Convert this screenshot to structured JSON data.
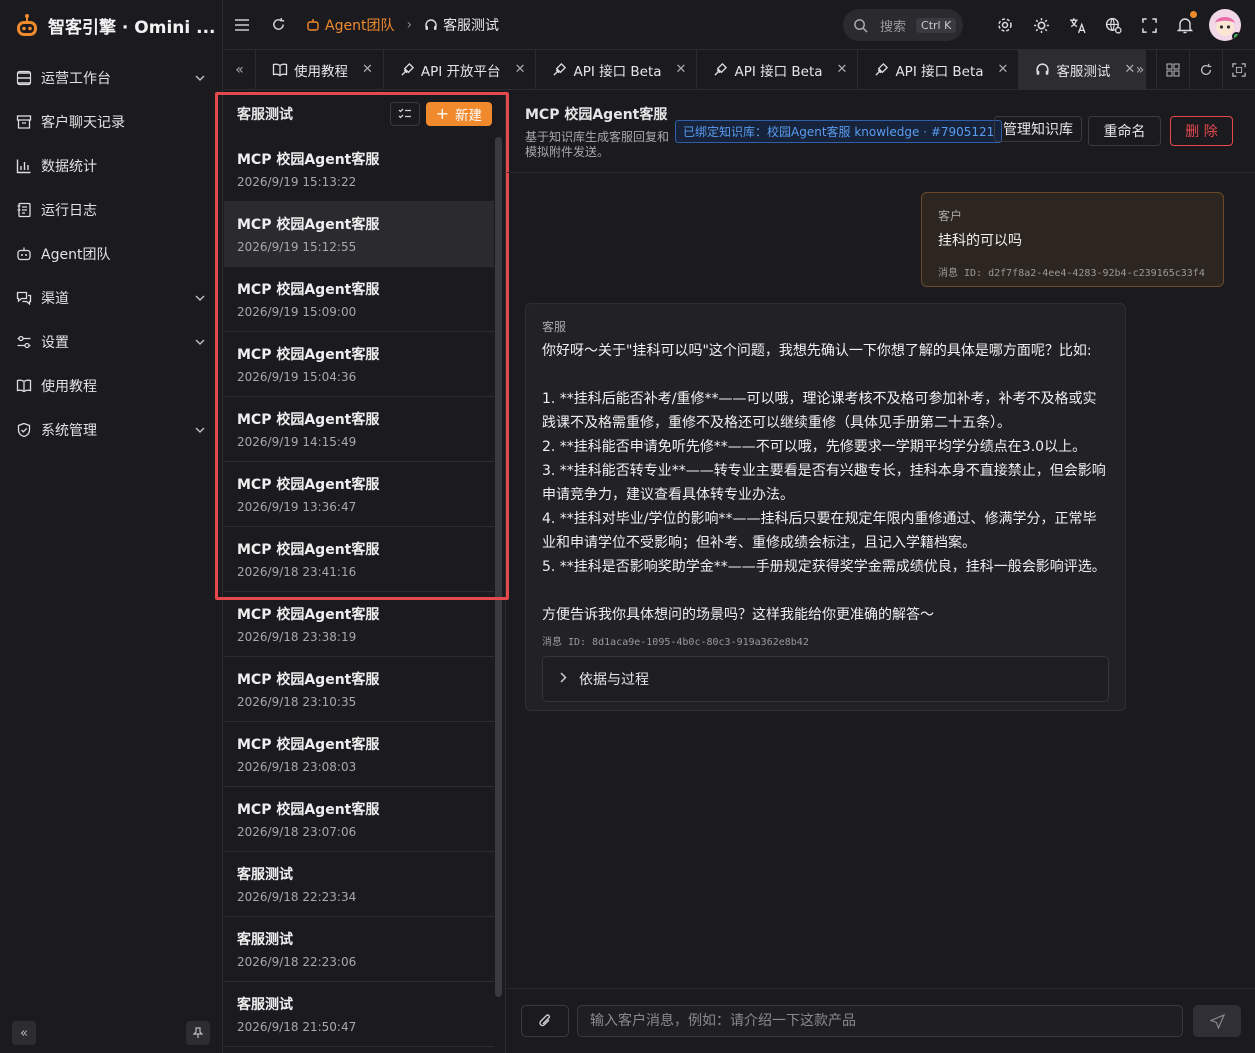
{
  "app": {
    "title": "智客引擎 · Omini ..."
  },
  "sidebar": {
    "items": [
      {
        "label": "运营工作台",
        "icon": "layers-icon",
        "chevron": true
      },
      {
        "label": "客户聊天记录",
        "icon": "archive-icon",
        "chevron": false
      },
      {
        "label": "数据统计",
        "icon": "bar-chart-icon",
        "chevron": false
      },
      {
        "label": "运行日志",
        "icon": "log-icon",
        "chevron": false
      },
      {
        "label": "Agent团队",
        "icon": "bot-icon",
        "chevron": false
      },
      {
        "label": "渠道",
        "icon": "chat-icon",
        "chevron": true
      },
      {
        "label": "设置",
        "icon": "sliders-icon",
        "chevron": true
      },
      {
        "label": "使用教程",
        "icon": "book-icon",
        "chevron": false
      },
      {
        "label": "系统管理",
        "icon": "shield-icon",
        "chevron": true
      }
    ]
  },
  "header": {
    "breadcrumb": {
      "parent": "Agent团队",
      "current": "客服测试"
    },
    "search": {
      "placeholder": "搜索",
      "shortcut": "Ctrl K"
    },
    "accent": "#f08a2d"
  },
  "tabs": [
    {
      "label": "使用教程",
      "icon": "book-icon",
      "active": false
    },
    {
      "label": "API 开放平台",
      "icon": "api-icon",
      "active": false
    },
    {
      "label": "API 接口 Beta",
      "icon": "api-icon",
      "active": false
    },
    {
      "label": "API 接口 Beta",
      "icon": "api-icon",
      "active": false
    },
    {
      "label": "API 接口 Beta",
      "icon": "api-icon",
      "active": false
    },
    {
      "label": "客服测试",
      "icon": "headset-icon",
      "active": true
    }
  ],
  "list": {
    "title": "客服测试",
    "new_label": "新建",
    "items": [
      {
        "title": "MCP 校园Agent客服",
        "time": "2026/9/19 15:13:22",
        "selected": false
      },
      {
        "title": "MCP 校园Agent客服",
        "time": "2026/9/19 15:12:55",
        "selected": true
      },
      {
        "title": "MCP 校园Agent客服",
        "time": "2026/9/19 15:09:00",
        "selected": false
      },
      {
        "title": "MCP 校园Agent客服",
        "time": "2026/9/19 15:04:36",
        "selected": false
      },
      {
        "title": "MCP 校园Agent客服",
        "time": "2026/9/19 14:15:49",
        "selected": false
      },
      {
        "title": "MCP 校园Agent客服",
        "time": "2026/9/19 13:36:47",
        "selected": false
      },
      {
        "title": "MCP 校园Agent客服",
        "time": "2026/9/18 23:41:16",
        "selected": false
      },
      {
        "title": "MCP 校园Agent客服",
        "time": "2026/9/18 23:38:19",
        "selected": false
      },
      {
        "title": "MCP 校园Agent客服",
        "time": "2026/9/18 23:10:35",
        "selected": false
      },
      {
        "title": "MCP 校园Agent客服",
        "time": "2026/9/18 23:08:03",
        "selected": false
      },
      {
        "title": "MCP 校园Agent客服",
        "time": "2026/9/18 23:07:06",
        "selected": false
      },
      {
        "title": "客服测试",
        "time": "2026/9/18 22:23:34",
        "selected": false
      },
      {
        "title": "客服测试",
        "time": "2026/9/18 22:23:06",
        "selected": false
      },
      {
        "title": "客服测试",
        "time": "2026/9/18 21:50:47",
        "selected": false
      }
    ]
  },
  "chat": {
    "title": "MCP 校园Agent客服",
    "description": "基于知识库生成客服回复和模拟附件发送。",
    "kb_badge": "已绑定知识库：校园Agent客服 knowledge · #7905121",
    "manage_kb": "管理知识库",
    "rename": "重命名",
    "delete": "删 除",
    "user_msg": {
      "role": "客户",
      "text": "挂科的可以吗",
      "id": "消息 ID: d2f7f8a2-4ee4-4283-92b4-c239165c33f4"
    },
    "agent_msg": {
      "role": "客服",
      "lines": [
        "你好呀～关于\"挂科可以吗\"这个问题，我想先确认一下你想了解的具体是哪方面呢？比如:",
        "",
        "1. **挂科后能否补考/重修**——可以哦，理论课考核不及格可参加补考，补考不及格或实践课不及格需重修，重修不及格还可以继续重修（具体见手册第二十五条）。",
        "2. **挂科能否申请免听先修**——不可以哦，先修要求一学期平均学分绩点在3.0以上。",
        "3. **挂科能否转专业**——转专业主要看是否有兴趣专长，挂科本身不直接禁止，但会影响申请竞争力，建议查看具体转专业办法。",
        "4. **挂科对毕业/学位的影响**——挂科后只要在规定年限内重修通过、修满学分，正常毕业和申请学位不受影响；但补考、重修成绩会标注，且记入学籍档案。",
        "5. **挂科是否影响奖助学金**——手册规定获得奖学金需成绩优良，挂科一般会影响评选。",
        "",
        "方便告诉我你具体想问的场景吗？这样我能给你更准确的解答～"
      ],
      "id": "消息 ID: 8d1aca9e-1095-4b0c-80c3-919a362e8b42",
      "fold_label": "依据与过程"
    },
    "composer_placeholder": "输入客户消息，例如：请介绍一下这款产品"
  }
}
